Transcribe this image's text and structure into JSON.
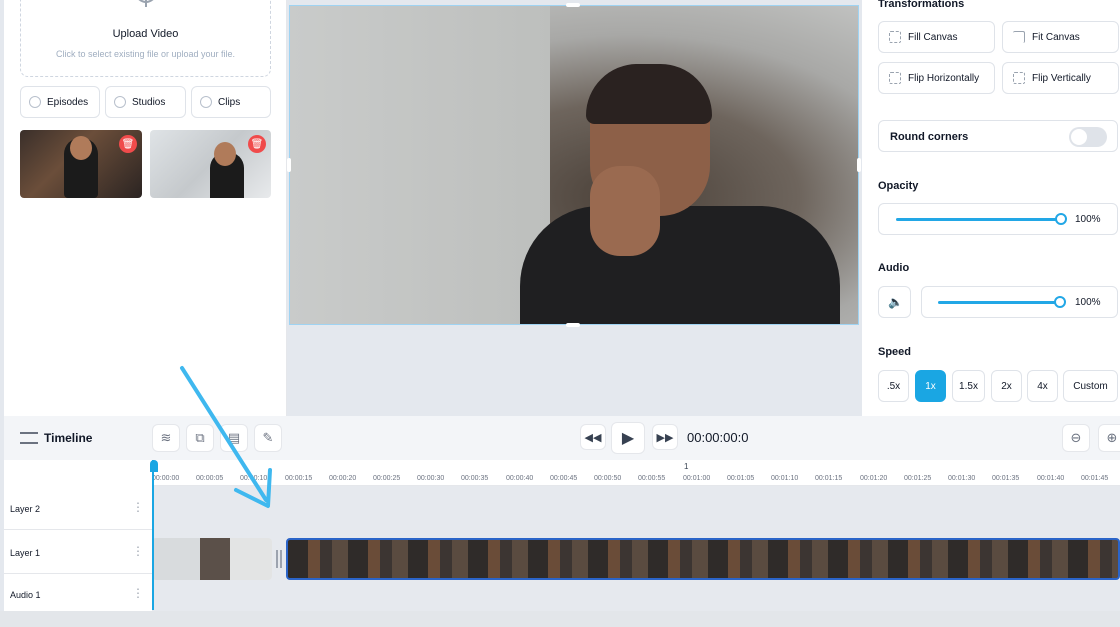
{
  "upload": {
    "title": "Upload Video",
    "subtitle": "Click to select existing file or upload your file."
  },
  "filters": [
    {
      "label": "Episodes"
    },
    {
      "label": "Studios"
    },
    {
      "label": "Clips"
    }
  ],
  "right_panel": {
    "transformations_title": "Transformations",
    "fill_canvas": "Fill Canvas",
    "fit_canvas": "Fit Canvas",
    "flip_horizontally": "Flip Horizontally",
    "flip_vertically": "Flip Vertically",
    "round_corners": "Round corners",
    "opacity_title": "Opacity",
    "opacity_value": "100%",
    "audio_title": "Audio",
    "audio_value": "100%",
    "speed_title": "Speed",
    "speed_options": [
      ".5x",
      "1x",
      "1.5x",
      "2x",
      "4x",
      "Custom"
    ],
    "speed_selected": "1x"
  },
  "timeline": {
    "title": "Timeline",
    "timecode": "00:00:00:0",
    "ruler_marker": "1",
    "ticks": [
      "00:00:00",
      "00:00:05",
      "00:00:10",
      "00:00:15",
      "00:00:20",
      "00:00:25",
      "00:00:30",
      "00:00:35",
      "00:00:40",
      "00:00:45",
      "00:00:50",
      "00:00:55",
      "00:01:00",
      "00:01:05",
      "00:01:10",
      "00:01:15",
      "00:01:20",
      "00:01:25",
      "00:01:30",
      "00:01:35",
      "00:01:40",
      "00:01:45"
    ],
    "tracks": [
      "Layer 2",
      "Layer 1",
      "Audio 1"
    ]
  },
  "colors": {
    "accent": "#1aa6e3",
    "delete": "#f04b4b",
    "clip_border": "#2b64c8"
  }
}
